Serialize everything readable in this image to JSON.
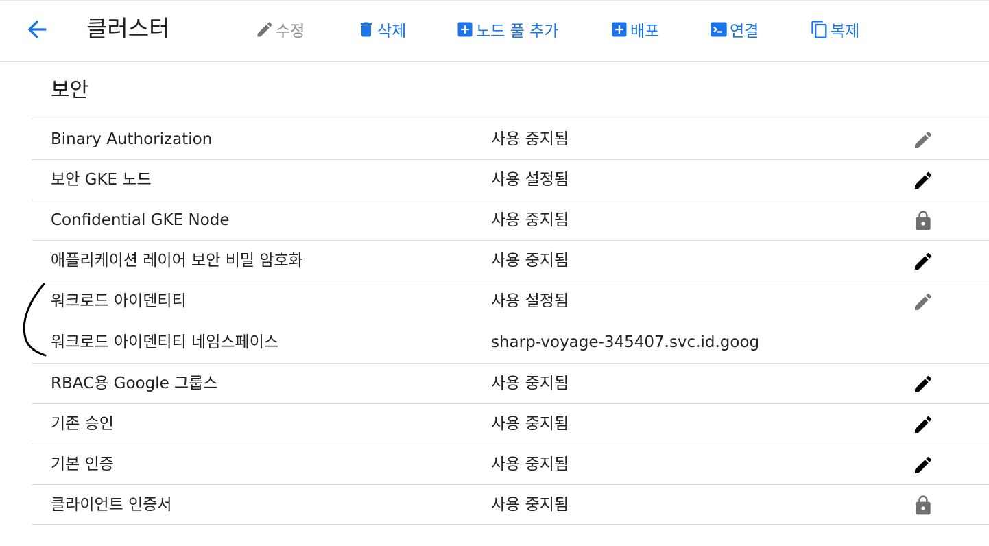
{
  "header": {
    "title": "클러스터",
    "back_icon": "arrow-back-icon",
    "actions": [
      {
        "label": "수정",
        "icon": "pencil-icon",
        "enabled": false
      },
      {
        "label": "삭제",
        "icon": "trash-icon",
        "enabled": true
      },
      {
        "label": "노드 풀 추가",
        "icon": "add-box-icon",
        "enabled": true
      },
      {
        "label": "배포",
        "icon": "add-box-icon",
        "enabled": true
      },
      {
        "label": "연결",
        "icon": "terminal-icon",
        "enabled": true
      },
      {
        "label": "복제",
        "icon": "copy-icon",
        "enabled": true
      }
    ],
    "accent_color": "#1a73e8"
  },
  "section": {
    "title": "보안",
    "rows": [
      {
        "label": "Binary Authorization",
        "value": "사용 중지됨",
        "icon": "edit-icon",
        "icon_state": "disabled"
      },
      {
        "label": "보안 GKE 노드",
        "value": "사용 설정됨",
        "icon": "edit-icon",
        "icon_state": "enabled"
      },
      {
        "label": "Confidential GKE Node",
        "value": "사용 중지됨",
        "icon": "lock-icon",
        "icon_state": "locked"
      },
      {
        "label": "애플리케이션 레이어 보안 비밀 암호화",
        "value": "사용 중지됨",
        "icon": "edit-icon",
        "icon_state": "enabled"
      },
      {
        "label": "워크로드 아이덴티티",
        "value": "사용 설정됨",
        "icon": "edit-icon",
        "icon_state": "disabled",
        "sub_label": "워크로드 아이덴티티 네임스페이스",
        "sub_value": "sharp-voyage-345407.svc.id.goog"
      },
      {
        "label": "RBAC용 Google 그룹스",
        "value": "사용 중지됨",
        "icon": "edit-icon",
        "icon_state": "enabled"
      },
      {
        "label": "기존 승인",
        "value": "사용 중지됨",
        "icon": "edit-icon",
        "icon_state": "enabled"
      },
      {
        "label": "기본 인증",
        "value": "사용 중지됨",
        "icon": "edit-icon",
        "icon_state": "enabled"
      },
      {
        "label": "클라이언트 인증서",
        "value": "사용 중지됨",
        "icon": "lock-icon",
        "icon_state": "locked"
      }
    ]
  }
}
